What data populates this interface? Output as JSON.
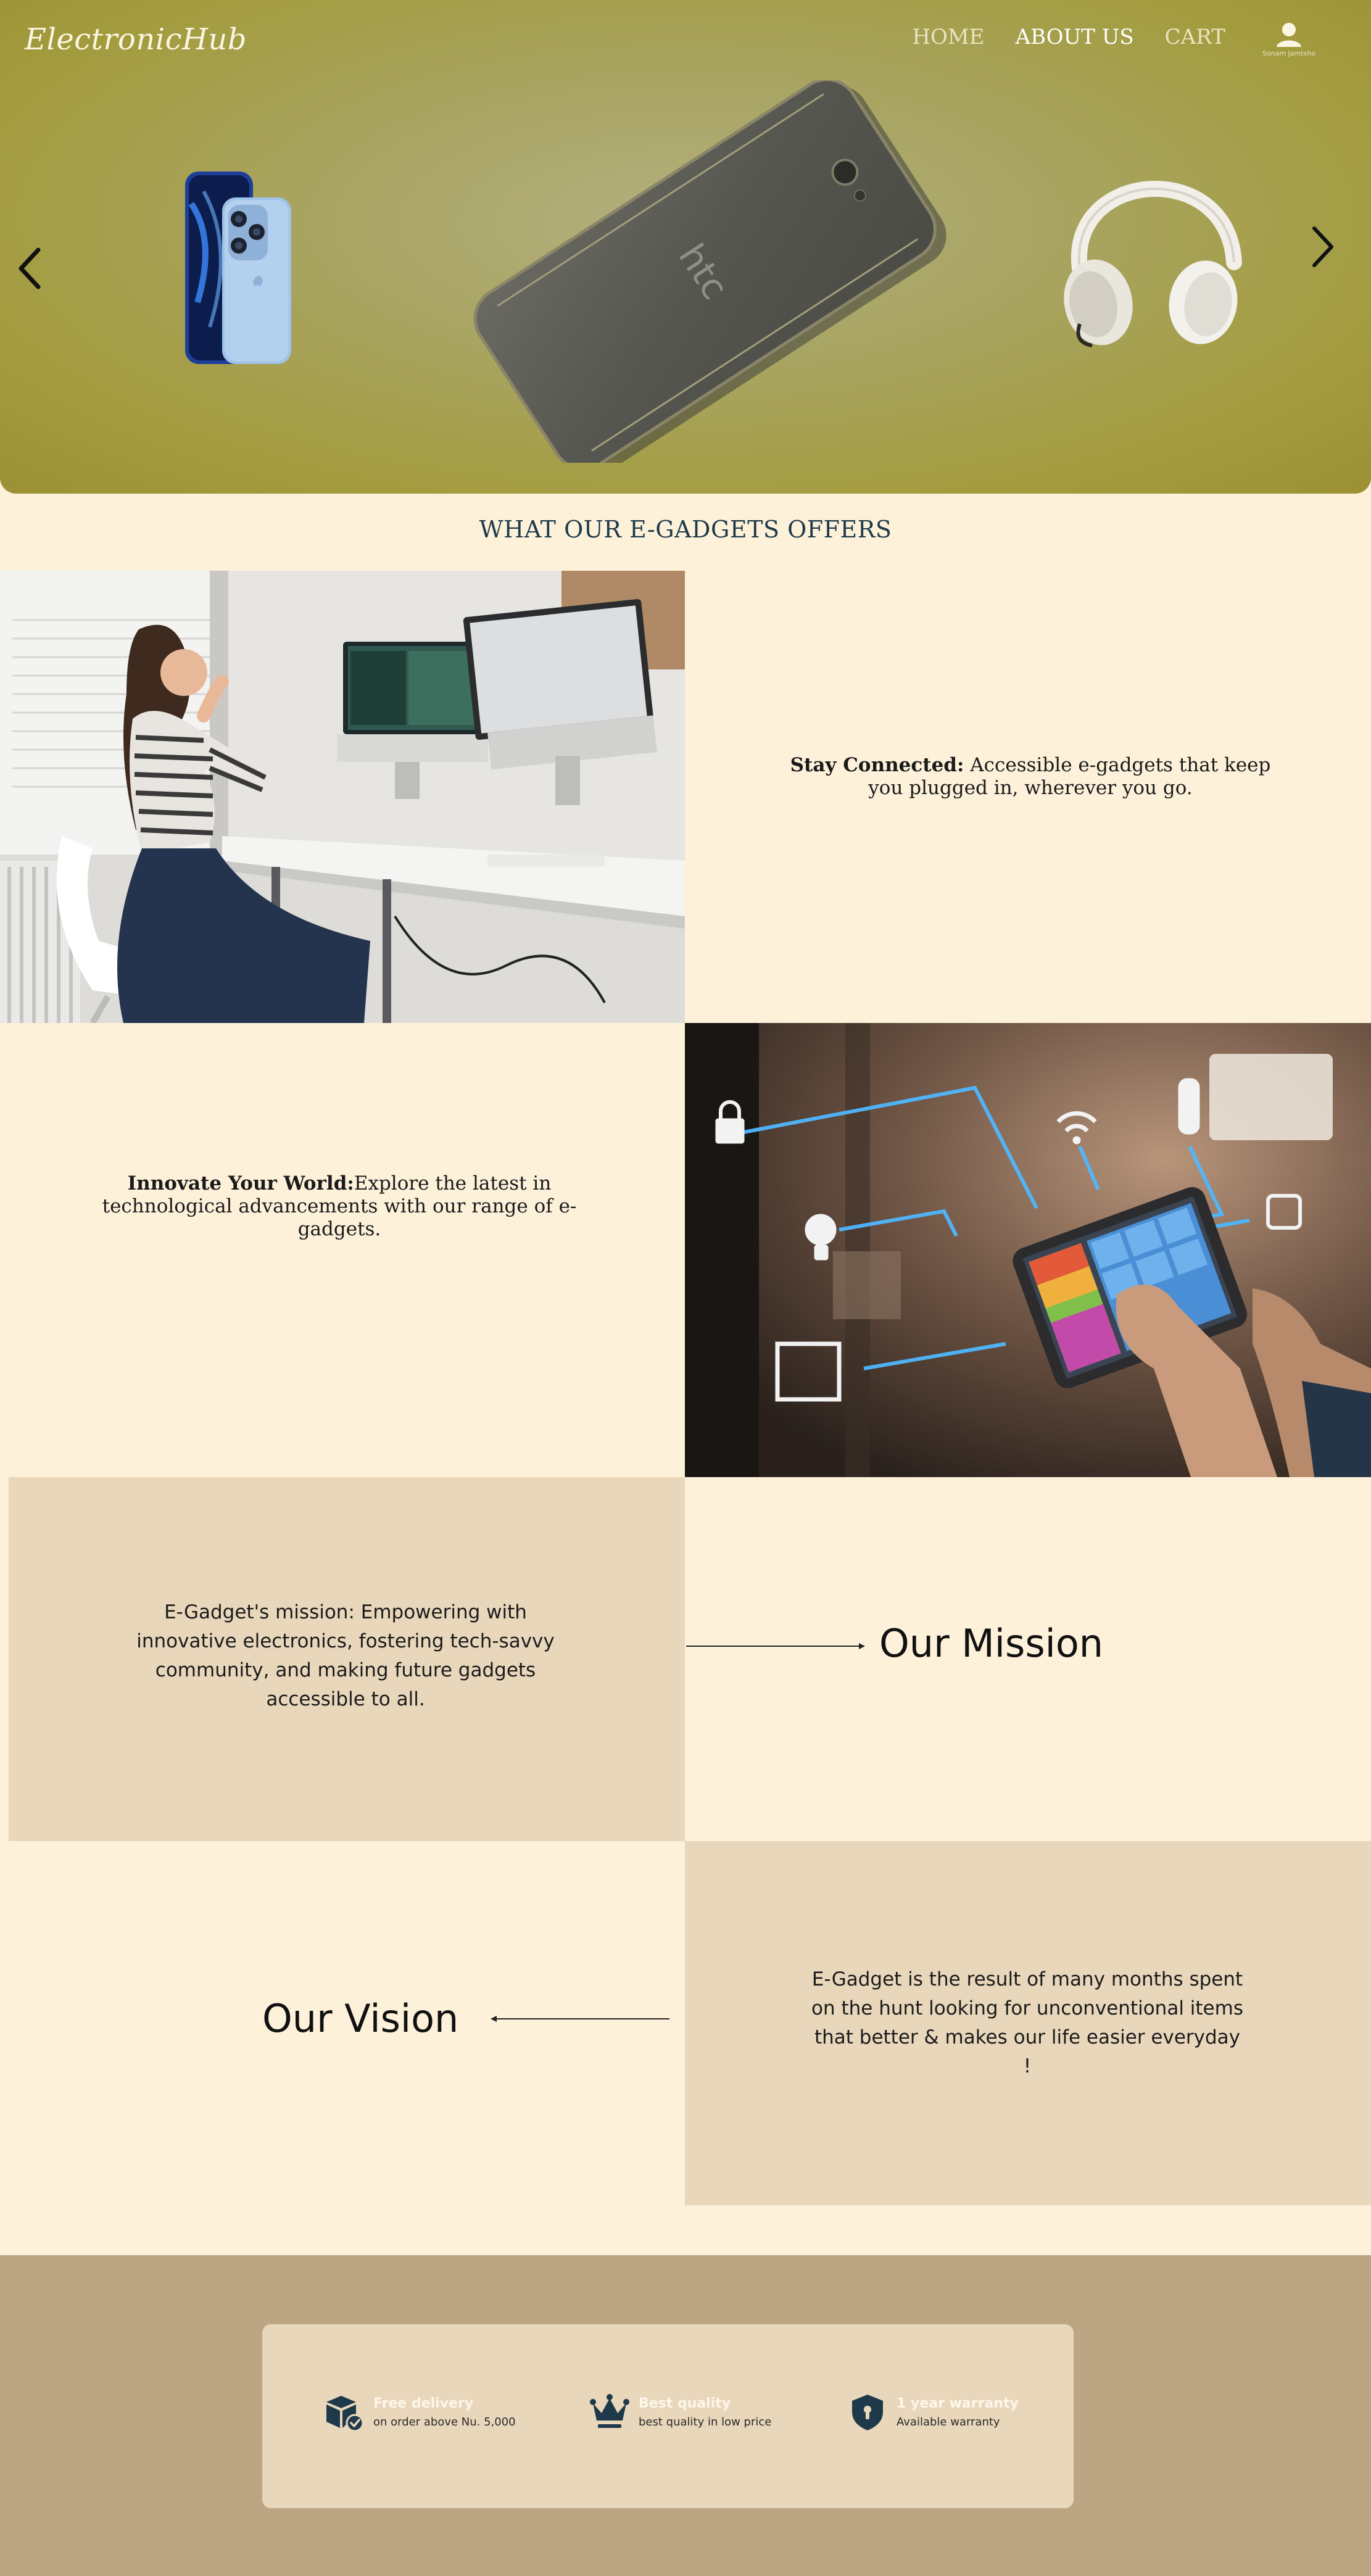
{
  "header": {
    "brand": "ElectronicHub",
    "nav": [
      {
        "label": "HOME",
        "active": false
      },
      {
        "label": "ABOUT US",
        "active": true
      },
      {
        "label": "CART",
        "active": false
      }
    ],
    "user_name": "Sonam Jamtsho",
    "user_icon": "user-icon"
  },
  "hero": {
    "prev_icon": "chevron-left-icon",
    "next_icon": "chevron-right-icon",
    "products": [
      "iphone-image",
      "htc-phone-image",
      "headphones-image"
    ],
    "htc_logo": "htc"
  },
  "offers": {
    "title": "WHAT OUR E-GADGETS OFFERS",
    "item1": {
      "bold": "Stay Connected:",
      "text": " Accessible e-gadgets that keep you plugged in, wherever you go."
    },
    "item2": {
      "bold": "Innovate Your World:",
      "text": "Explore the latest in technological advancements with our range of e-gadgets."
    }
  },
  "mission": {
    "heading": "Our Mission",
    "text": "E-Gadget's mission: Empowering with innovative electronics, fostering tech-savvy community, and making future gadgets accessible to all."
  },
  "vision": {
    "heading": "Our Vision",
    "text": "E-Gadget is the result of many months spent on the hunt looking for unconventional items that better & makes our life easier everyday !"
  },
  "features": [
    {
      "icon": "delivery-box-icon",
      "title": "Free delivery",
      "subtitle": "on order above Nu. 5,000"
    },
    {
      "icon": "crown-icon",
      "title": "Best quality",
      "subtitle": "best quality in low price"
    },
    {
      "icon": "shield-icon",
      "title": "1 year warranty",
      "subtitle": "Available warranty"
    }
  ],
  "colors": {
    "background": "#fdf1da",
    "panel": "#e9d7bb",
    "footer": "#bca583",
    "title": "#1e3a4a",
    "icon_dark": "#1e3a4a"
  }
}
